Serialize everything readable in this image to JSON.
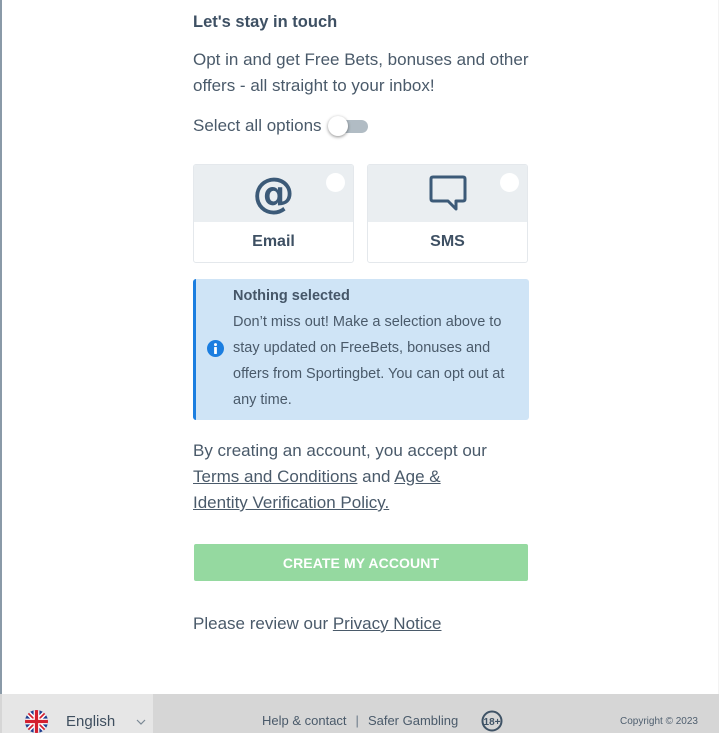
{
  "section": {
    "title": "Let's stay in touch",
    "intro": "Opt in and get Free Bets, bonuses and other offers - all straight to your inbox!",
    "select_all_label": "Select all options",
    "select_all_on": false
  },
  "channels": [
    {
      "label": "Email",
      "icon": "at-sign-icon",
      "glyph": "@",
      "selected": false
    },
    {
      "label": "SMS",
      "icon": "speech-bubble-icon",
      "selected": false
    }
  ],
  "notice": {
    "heading": "Nothing selected",
    "body": "Don’t miss out! Make a selection above to stay updated on FreeBets, bonuses and offers from Sportingbet. You can opt out at any time.",
    "icon": "info-icon",
    "accent_color": "#1b7ee0"
  },
  "terms": {
    "prefix": "By creating an account, you accept our ",
    "terms_link": "Terms and Conditions",
    "middle": " and ",
    "policy_link": "Age & Identity Verification Policy."
  },
  "create_button": {
    "label": "CREATE MY ACCOUNT",
    "color": "#95d9a0",
    "enabled": false
  },
  "privacy": {
    "prefix": "Please review our ",
    "link": "Privacy Notice"
  },
  "footer": {
    "language": "English",
    "language_icon": "uk-flag-icon",
    "links": [
      "Help & contact",
      "Safer Gambling"
    ],
    "separator": "|",
    "age_badge": "18+",
    "copyright": "Copyright © 2023"
  }
}
